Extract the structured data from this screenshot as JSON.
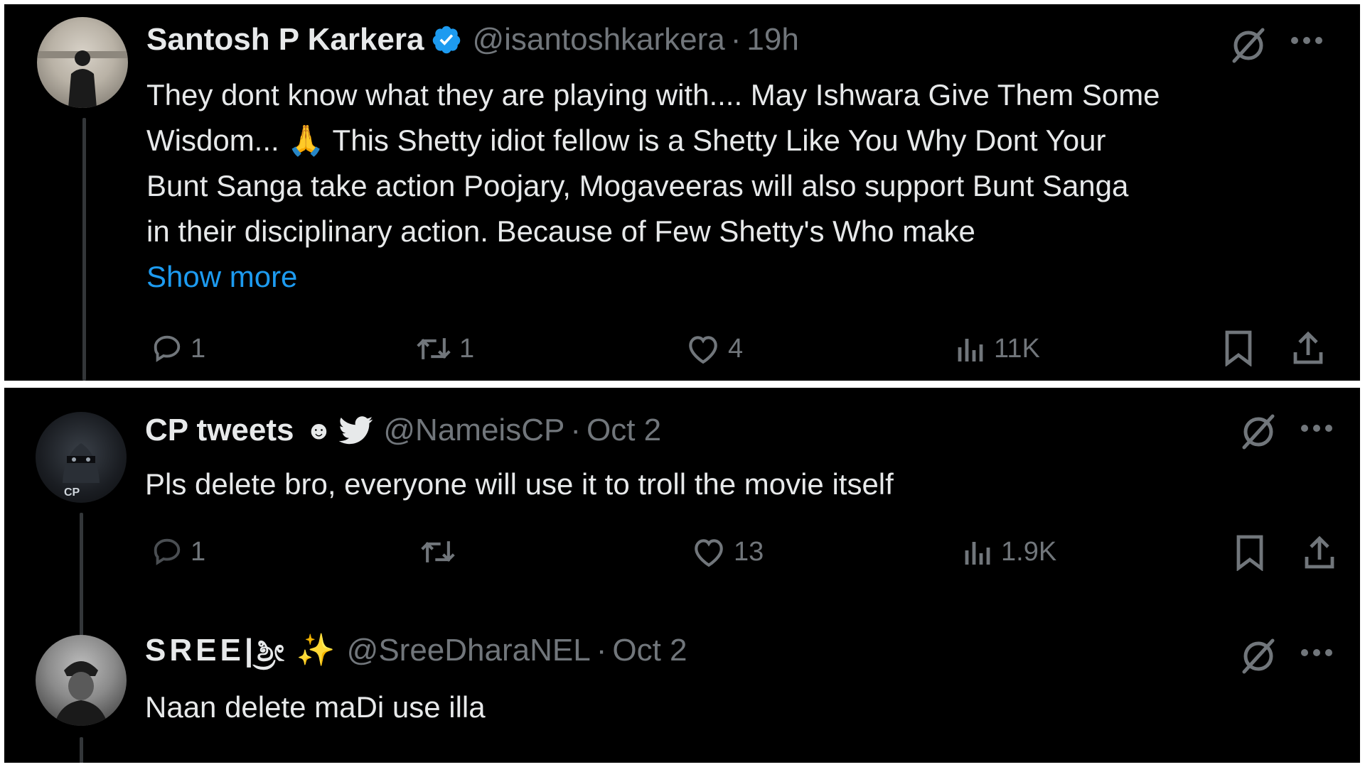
{
  "tweets": [
    {
      "name": "Santosh P Karkera",
      "handle": "@isantoshkarkera",
      "dot": "·",
      "time": "19h",
      "text_lines": [
        "They dont know what they are playing with.... May Ishwara Give Them Some",
        "Wisdom... 🙏 This Shetty idiot fellow is a Shetty Like You Why Dont Your",
        "Bunt Sanga take action Poojary, Mogaveeras will also support Bunt Sanga",
        "in their disciplinary action. Because of Few Shetty's Who make"
      ],
      "show_more": "Show more",
      "replies": "1",
      "reposts": "1",
      "likes": "4",
      "views": "11K",
      "verified_color": "#1d9bf0"
    },
    {
      "name": "CP tweets",
      "name_suffix": "☻",
      "handle": "@NameisCP",
      "dot": "·",
      "time": "Oct 2",
      "text": "Pls delete bro, everyone will use it to troll the movie itself",
      "replies": "1",
      "reposts": "",
      "likes": "13",
      "views": "1.9K",
      "avatar_text": "CP"
    },
    {
      "name": "SREE|ಶ್ರೀ",
      "name_suffix": "✨",
      "handle": "@SreeDharaNEL",
      "dot": "·",
      "time": "Oct 2",
      "text": "Naan delete maDi use illa"
    }
  ],
  "icons": {
    "reply": "reply-icon",
    "repost": "repost-icon",
    "like": "heart-icon",
    "views": "views-icon",
    "bookmark": "bookmark-icon",
    "share": "share-icon",
    "grok": "grok-icon",
    "more": "more-icon"
  },
  "colors": {
    "background": "#000000",
    "text": "#e7e9ea",
    "muted": "#71767b",
    "link": "#1d9bf0"
  }
}
